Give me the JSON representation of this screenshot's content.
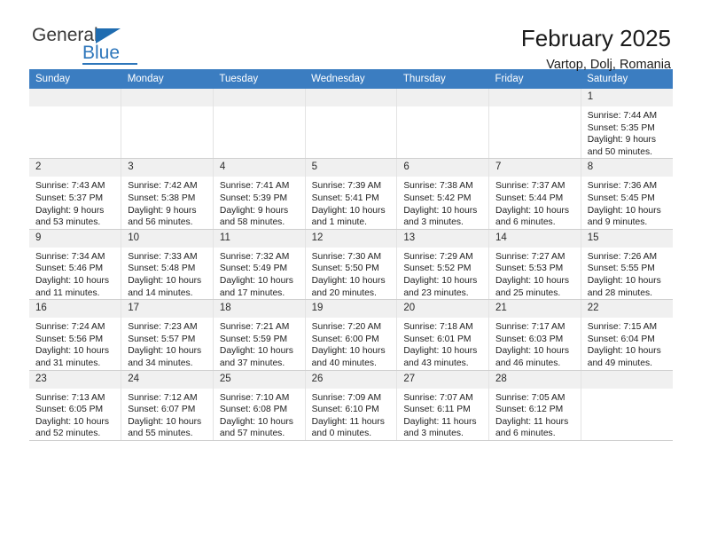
{
  "brand": {
    "name_part1": "General",
    "name_part2": "Blue",
    "logo_icon": "blue-triangle-flag-icon"
  },
  "header": {
    "title": "February 2025",
    "subtitle": "Vartop, Dolj, Romania"
  },
  "colors": {
    "header_blue": "#3b7dc1",
    "brand_blue": "#2d76bb",
    "daynum_bg": "#f0f0f0",
    "grid_line": "#cfcfcf"
  },
  "weekdays": [
    "Sunday",
    "Monday",
    "Tuesday",
    "Wednesday",
    "Thursday",
    "Friday",
    "Saturday"
  ],
  "weeks": [
    [
      {
        "day": "",
        "sunrise": "",
        "sunset": "",
        "daylight": "",
        "daylight2": "",
        "empty": true
      },
      {
        "day": "",
        "sunrise": "",
        "sunset": "",
        "daylight": "",
        "daylight2": "",
        "empty": true
      },
      {
        "day": "",
        "sunrise": "",
        "sunset": "",
        "daylight": "",
        "daylight2": "",
        "empty": true
      },
      {
        "day": "",
        "sunrise": "",
        "sunset": "",
        "daylight": "",
        "daylight2": "",
        "empty": true
      },
      {
        "day": "",
        "sunrise": "",
        "sunset": "",
        "daylight": "",
        "daylight2": "",
        "empty": true
      },
      {
        "day": "",
        "sunrise": "",
        "sunset": "",
        "daylight": "",
        "daylight2": "",
        "empty": true
      },
      {
        "day": "1",
        "sunrise": "Sunrise: 7:44 AM",
        "sunset": "Sunset: 5:35 PM",
        "daylight": "Daylight: 9 hours",
        "daylight2": "and 50 minutes.",
        "empty": false
      }
    ],
    [
      {
        "day": "2",
        "sunrise": "Sunrise: 7:43 AM",
        "sunset": "Sunset: 5:37 PM",
        "daylight": "Daylight: 9 hours",
        "daylight2": "and 53 minutes.",
        "empty": false
      },
      {
        "day": "3",
        "sunrise": "Sunrise: 7:42 AM",
        "sunset": "Sunset: 5:38 PM",
        "daylight": "Daylight: 9 hours",
        "daylight2": "and 56 minutes.",
        "empty": false
      },
      {
        "day": "4",
        "sunrise": "Sunrise: 7:41 AM",
        "sunset": "Sunset: 5:39 PM",
        "daylight": "Daylight: 9 hours",
        "daylight2": "and 58 minutes.",
        "empty": false
      },
      {
        "day": "5",
        "sunrise": "Sunrise: 7:39 AM",
        "sunset": "Sunset: 5:41 PM",
        "daylight": "Daylight: 10 hours",
        "daylight2": "and 1 minute.",
        "empty": false
      },
      {
        "day": "6",
        "sunrise": "Sunrise: 7:38 AM",
        "sunset": "Sunset: 5:42 PM",
        "daylight": "Daylight: 10 hours",
        "daylight2": "and 3 minutes.",
        "empty": false
      },
      {
        "day": "7",
        "sunrise": "Sunrise: 7:37 AM",
        "sunset": "Sunset: 5:44 PM",
        "daylight": "Daylight: 10 hours",
        "daylight2": "and 6 minutes.",
        "empty": false
      },
      {
        "day": "8",
        "sunrise": "Sunrise: 7:36 AM",
        "sunset": "Sunset: 5:45 PM",
        "daylight": "Daylight: 10 hours",
        "daylight2": "and 9 minutes.",
        "empty": false
      }
    ],
    [
      {
        "day": "9",
        "sunrise": "Sunrise: 7:34 AM",
        "sunset": "Sunset: 5:46 PM",
        "daylight": "Daylight: 10 hours",
        "daylight2": "and 11 minutes.",
        "empty": false
      },
      {
        "day": "10",
        "sunrise": "Sunrise: 7:33 AM",
        "sunset": "Sunset: 5:48 PM",
        "daylight": "Daylight: 10 hours",
        "daylight2": "and 14 minutes.",
        "empty": false
      },
      {
        "day": "11",
        "sunrise": "Sunrise: 7:32 AM",
        "sunset": "Sunset: 5:49 PM",
        "daylight": "Daylight: 10 hours",
        "daylight2": "and 17 minutes.",
        "empty": false
      },
      {
        "day": "12",
        "sunrise": "Sunrise: 7:30 AM",
        "sunset": "Sunset: 5:50 PM",
        "daylight": "Daylight: 10 hours",
        "daylight2": "and 20 minutes.",
        "empty": false
      },
      {
        "day": "13",
        "sunrise": "Sunrise: 7:29 AM",
        "sunset": "Sunset: 5:52 PM",
        "daylight": "Daylight: 10 hours",
        "daylight2": "and 23 minutes.",
        "empty": false
      },
      {
        "day": "14",
        "sunrise": "Sunrise: 7:27 AM",
        "sunset": "Sunset: 5:53 PM",
        "daylight": "Daylight: 10 hours",
        "daylight2": "and 25 minutes.",
        "empty": false
      },
      {
        "day": "15",
        "sunrise": "Sunrise: 7:26 AM",
        "sunset": "Sunset: 5:55 PM",
        "daylight": "Daylight: 10 hours",
        "daylight2": "and 28 minutes.",
        "empty": false
      }
    ],
    [
      {
        "day": "16",
        "sunrise": "Sunrise: 7:24 AM",
        "sunset": "Sunset: 5:56 PM",
        "daylight": "Daylight: 10 hours",
        "daylight2": "and 31 minutes.",
        "empty": false
      },
      {
        "day": "17",
        "sunrise": "Sunrise: 7:23 AM",
        "sunset": "Sunset: 5:57 PM",
        "daylight": "Daylight: 10 hours",
        "daylight2": "and 34 minutes.",
        "empty": false
      },
      {
        "day": "18",
        "sunrise": "Sunrise: 7:21 AM",
        "sunset": "Sunset: 5:59 PM",
        "daylight": "Daylight: 10 hours",
        "daylight2": "and 37 minutes.",
        "empty": false
      },
      {
        "day": "19",
        "sunrise": "Sunrise: 7:20 AM",
        "sunset": "Sunset: 6:00 PM",
        "daylight": "Daylight: 10 hours",
        "daylight2": "and 40 minutes.",
        "empty": false
      },
      {
        "day": "20",
        "sunrise": "Sunrise: 7:18 AM",
        "sunset": "Sunset: 6:01 PM",
        "daylight": "Daylight: 10 hours",
        "daylight2": "and 43 minutes.",
        "empty": false
      },
      {
        "day": "21",
        "sunrise": "Sunrise: 7:17 AM",
        "sunset": "Sunset: 6:03 PM",
        "daylight": "Daylight: 10 hours",
        "daylight2": "and 46 minutes.",
        "empty": false
      },
      {
        "day": "22",
        "sunrise": "Sunrise: 7:15 AM",
        "sunset": "Sunset: 6:04 PM",
        "daylight": "Daylight: 10 hours",
        "daylight2": "and 49 minutes.",
        "empty": false
      }
    ],
    [
      {
        "day": "23",
        "sunrise": "Sunrise: 7:13 AM",
        "sunset": "Sunset: 6:05 PM",
        "daylight": "Daylight: 10 hours",
        "daylight2": "and 52 minutes.",
        "empty": false
      },
      {
        "day": "24",
        "sunrise": "Sunrise: 7:12 AM",
        "sunset": "Sunset: 6:07 PM",
        "daylight": "Daylight: 10 hours",
        "daylight2": "and 55 minutes.",
        "empty": false
      },
      {
        "day": "25",
        "sunrise": "Sunrise: 7:10 AM",
        "sunset": "Sunset: 6:08 PM",
        "daylight": "Daylight: 10 hours",
        "daylight2": "and 57 minutes.",
        "empty": false
      },
      {
        "day": "26",
        "sunrise": "Sunrise: 7:09 AM",
        "sunset": "Sunset: 6:10 PM",
        "daylight": "Daylight: 11 hours",
        "daylight2": "and 0 minutes.",
        "empty": false
      },
      {
        "day": "27",
        "sunrise": "Sunrise: 7:07 AM",
        "sunset": "Sunset: 6:11 PM",
        "daylight": "Daylight: 11 hours",
        "daylight2": "and 3 minutes.",
        "empty": false
      },
      {
        "day": "28",
        "sunrise": "Sunrise: 7:05 AM",
        "sunset": "Sunset: 6:12 PM",
        "daylight": "Daylight: 11 hours",
        "daylight2": "and 6 minutes.",
        "empty": false
      },
      {
        "day": "",
        "sunrise": "",
        "sunset": "",
        "daylight": "",
        "daylight2": "",
        "empty": true
      }
    ]
  ]
}
